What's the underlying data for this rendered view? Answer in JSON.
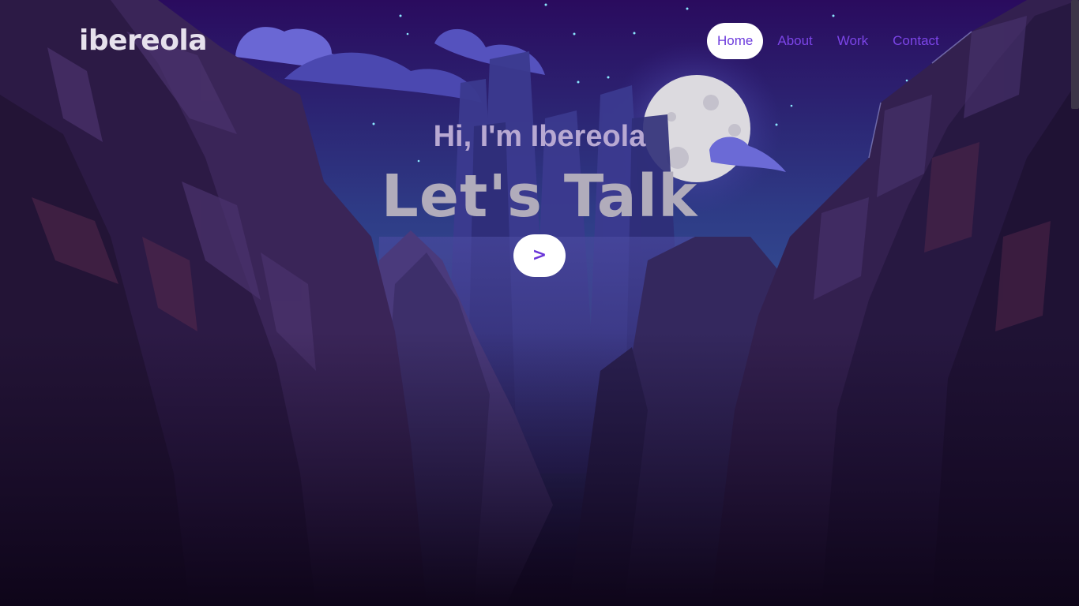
{
  "header": {
    "logo": "ibereola"
  },
  "nav": {
    "items": [
      {
        "label": "Home",
        "active": true
      },
      {
        "label": "About",
        "active": false
      },
      {
        "label": "Work",
        "active": false
      },
      {
        "label": "Contact",
        "active": false
      }
    ]
  },
  "hero": {
    "greeting": "Hi, I'm Ibereola",
    "title": "Let's Talk",
    "button_label": ">"
  },
  "colors": {
    "accent": "#7c45e8",
    "sky_top": "#2a0b5e",
    "sky_bottom": "#2d5c8f",
    "moon": "#dcdadf",
    "ground": "#120721"
  }
}
